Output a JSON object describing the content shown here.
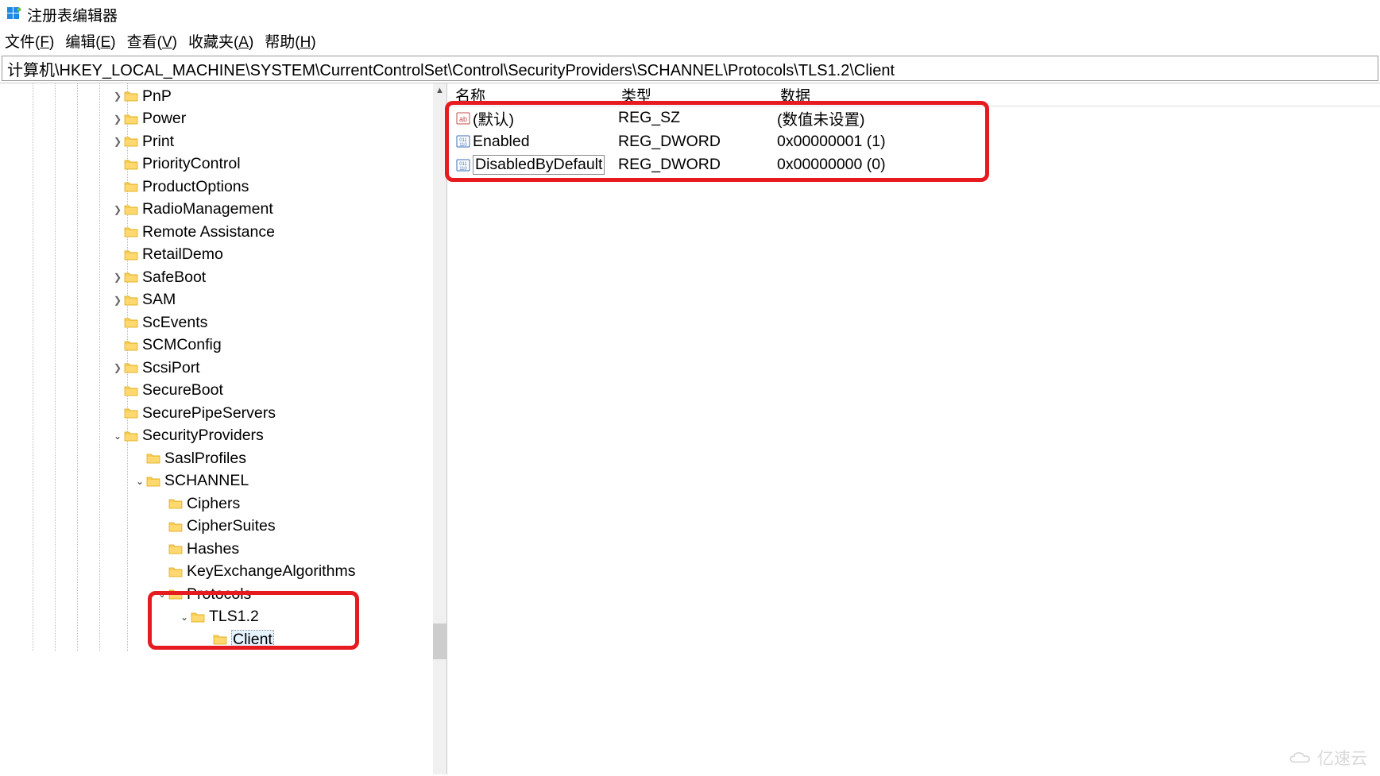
{
  "title": "注册表编辑器",
  "menu": {
    "file": "文件(<u>F</u>)",
    "edit": "编辑(<u>E</u>)",
    "view": "查看(<u>V</u>)",
    "fav": "收藏夹(<u>A</u>)",
    "help": "帮助(<u>H</u>)"
  },
  "path": "计算机\\HKEY_LOCAL_MACHINE\\SYSTEM\\CurrentControlSet\\Control\\SecurityProviders\\SCHANNEL\\Protocols\\TLS1.2\\Client",
  "tree": [
    {
      "label": "PnP",
      "indent": 140,
      "expander": "›"
    },
    {
      "label": "Power",
      "indent": 140,
      "expander": "›"
    },
    {
      "label": "Print",
      "indent": 140,
      "expander": "›"
    },
    {
      "label": "PriorityControl",
      "indent": 140,
      "expander": ""
    },
    {
      "label": "ProductOptions",
      "indent": 140,
      "expander": ""
    },
    {
      "label": "RadioManagement",
      "indent": 140,
      "expander": "›"
    },
    {
      "label": "Remote Assistance",
      "indent": 140,
      "expander": ""
    },
    {
      "label": "RetailDemo",
      "indent": 140,
      "expander": ""
    },
    {
      "label": "SafeBoot",
      "indent": 140,
      "expander": "›"
    },
    {
      "label": "SAM",
      "indent": 140,
      "expander": "›"
    },
    {
      "label": "ScEvents",
      "indent": 140,
      "expander": ""
    },
    {
      "label": "SCMConfig",
      "indent": 140,
      "expander": ""
    },
    {
      "label": "ScsiPort",
      "indent": 140,
      "expander": "›"
    },
    {
      "label": "SecureBoot",
      "indent": 140,
      "expander": ""
    },
    {
      "label": "SecurePipeServers",
      "indent": 140,
      "expander": ""
    },
    {
      "label": "SecurityProviders",
      "indent": 140,
      "expander": "⌄"
    },
    {
      "label": "SaslProfiles",
      "indent": 168,
      "expander": ""
    },
    {
      "label": "SCHANNEL",
      "indent": 168,
      "expander": "⌄"
    },
    {
      "label": "Ciphers",
      "indent": 196,
      "expander": ""
    },
    {
      "label": "CipherSuites",
      "indent": 196,
      "expander": ""
    },
    {
      "label": "Hashes",
      "indent": 196,
      "expander": ""
    },
    {
      "label": "KeyExchangeAlgorithms",
      "indent": 196,
      "expander": ""
    },
    {
      "label": "Protocols",
      "indent": 196,
      "expander": "⌄"
    },
    {
      "label": "TLS1.2",
      "indent": 224,
      "expander": "⌄"
    },
    {
      "label": "Client",
      "indent": 252,
      "expander": "",
      "selected": true
    }
  ],
  "columns": {
    "name": "名称",
    "type": "类型",
    "data": "数据"
  },
  "values": [
    {
      "icon": "sz",
      "name": "(默认)",
      "type": "REG_SZ",
      "data": "(数值未设置)"
    },
    {
      "icon": "dw",
      "name": "Enabled",
      "type": "REG_DWORD",
      "data": "0x00000001 (1)"
    },
    {
      "icon": "dw",
      "name": "DisabledByDefault",
      "type": "REG_DWORD",
      "data": "0x00000000 (0)",
      "boxed": true
    }
  ],
  "watermark": "亿速云"
}
